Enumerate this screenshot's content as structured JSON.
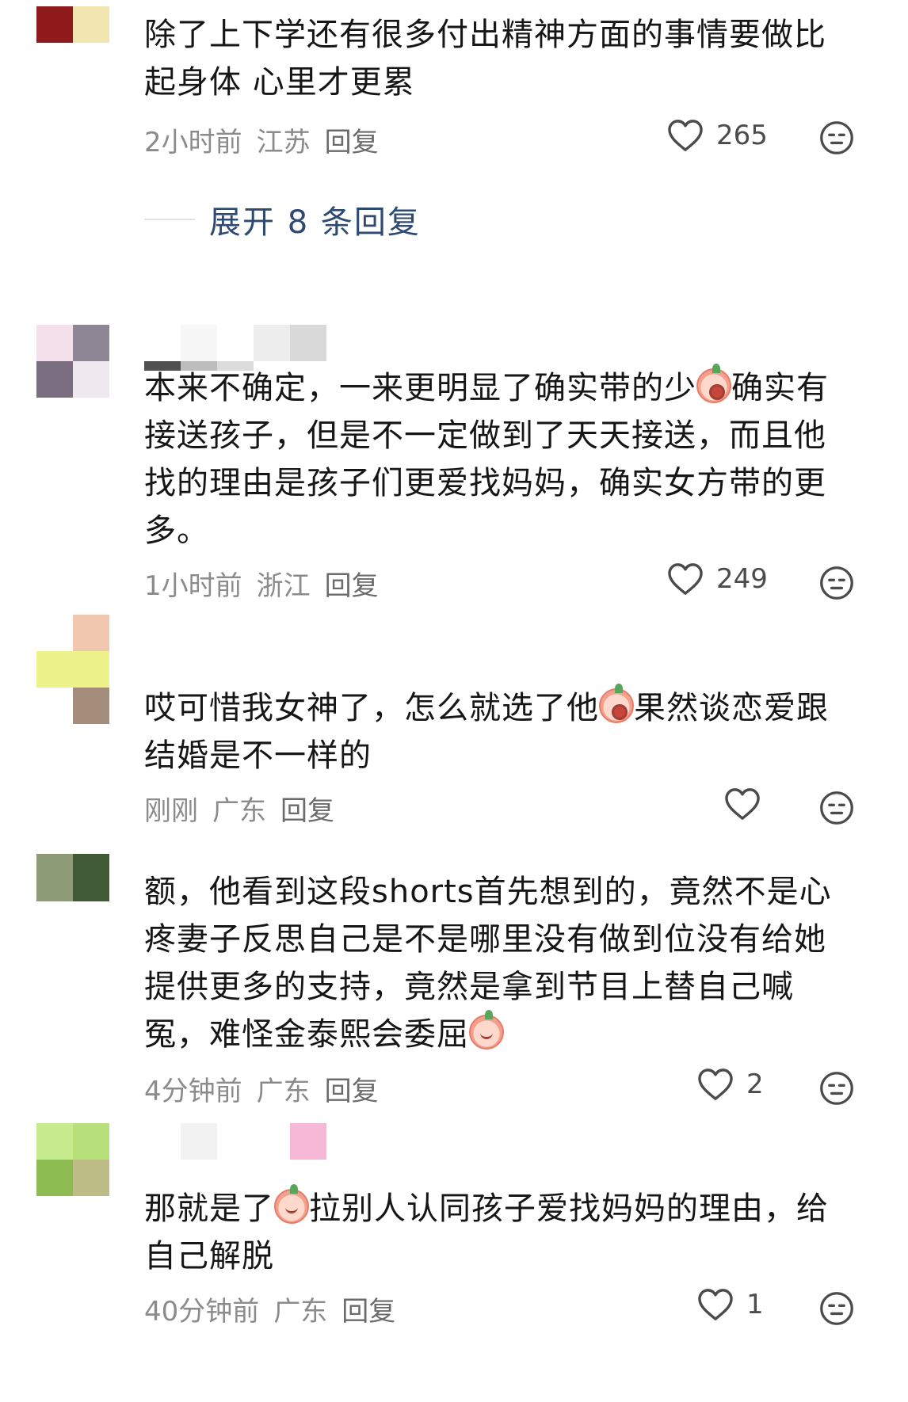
{
  "colors": {
    "background": "#ffffff",
    "text": "#161616",
    "meta": "#8b8b8b",
    "expand_link": "#2e4a72"
  },
  "comments": [
    {
      "text": "除了上下学还有很多付出精神方面的事情要做比起身体 心里才更累",
      "time": "2小时前",
      "location": "江苏",
      "reply": "回复",
      "likes": "265",
      "avatar_colors": [
        "#8e1a1c",
        "#f5e9b5",
        "#8e1a1c",
        "#ffffff"
      ]
    },
    {
      "text_parts": [
        "本来不确定，一来更明显了确实带的少",
        "确实有接送孩子，但是不一定做到了天天接送，而且他找的理由是孩子们更爱找妈妈，确实女方带的更多。"
      ],
      "time": "1小时前",
      "location": "浙江",
      "reply": "回复",
      "likes": "249",
      "avatar_colors": [
        "#f3e0ea",
        "#8e8695",
        "#7a6e80",
        "#efe8ee"
      ]
    },
    {
      "text_parts": [
        "哎可惜我女神了，怎么就选了他",
        "果然谈恋爱跟结婚是不一样的"
      ],
      "time": "刚刚",
      "location": "广东",
      "reply": "回复",
      "likes": "",
      "avatar_colors": [
        "#ffffff",
        "#f2c7b0",
        "#eef28a",
        "#a58d7c"
      ]
    },
    {
      "text_parts": [
        "额，他看到这段shorts首先想到的，竟然不是心疼妻子反思自己是不是哪里没有做到位没有给她提供更多的支持，竟然是拿到节目上替自己喊冤，难怪金泰熙会委屈",
        ""
      ],
      "time": "4分钟前",
      "location": "广东",
      "reply": "回复",
      "likes": "2",
      "avatar_colors": [
        "#8d9c76",
        "#3f5a34",
        "#ffffff",
        "#ffffff"
      ]
    },
    {
      "text_parts": [
        "那就是了",
        "拉别人认同孩子爱找妈妈的理由，给自己解脱"
      ],
      "time": "40分钟前",
      "location": "广东",
      "reply": "回复",
      "likes": "1",
      "avatar_colors": [
        "#c7ec8e",
        "#b8e07a",
        "#8cbc52",
        "#bdbb86"
      ]
    }
  ],
  "expand_replies": {
    "label": "展开 8 条回复"
  },
  "icons": {
    "like": "heart-outline-icon",
    "dislike": "neutral-face-icon",
    "emoji": "peach-emoji-icon"
  }
}
